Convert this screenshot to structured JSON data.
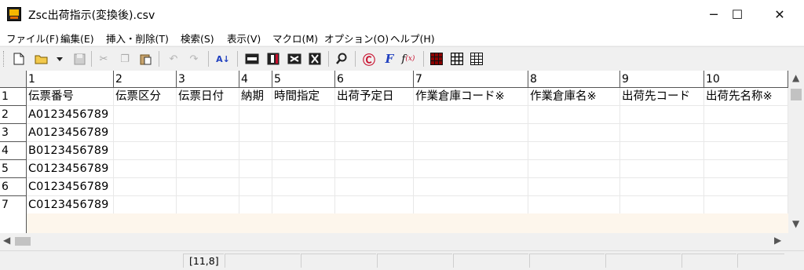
{
  "window": {
    "title": "Zsc出荷指示(変換後).csv",
    "minimize_glyph": "─",
    "maximize_glyph": "☐",
    "close_glyph": "✕"
  },
  "menu": [
    "ファイル(F)",
    "編集(E)",
    "挿入・削除(T)",
    "検索(S)",
    "表示(V)",
    "マクロ(M)",
    "オプション(O)",
    "ヘルプ(H)"
  ],
  "toolbar": {
    "icons": [
      "new-file-icon",
      "open-folder-icon",
      "dropdown-icon",
      "save-icon",
      "cut-icon",
      "copy-icon",
      "paste-icon",
      "undo-icon",
      "redo-icon",
      "sort-az-icon",
      "insert-row-icon",
      "insert-col-icon",
      "delete-row-icon",
      "delete-col-icon",
      "find-icon",
      "recalc-icon",
      "font-icon",
      "function-icon",
      "grid-bold-icon",
      "grid-icon",
      "grid-plain-icon"
    ],
    "colors": {
      "red": "#c8102e",
      "blue": "#1f3fbf",
      "dark": "#222222"
    }
  },
  "grid": {
    "column_numbers": [
      "1",
      "2",
      "3",
      "4",
      "5",
      "6",
      "7",
      "8",
      "9",
      "10"
    ],
    "header_cells": [
      "伝票番号",
      "伝票区分",
      "伝票日付",
      "納期",
      "時間指定",
      "出荷予定日",
      "作業倉庫コード※",
      "作業倉庫名※",
      "出荷先コード",
      "出荷先名称※"
    ],
    "row_numbers": [
      "1",
      "2",
      "3",
      "4",
      "5",
      "6",
      "7"
    ],
    "data_rows": [
      [
        "A0123456789"
      ],
      [
        "A0123456789"
      ],
      [
        "B0123456789"
      ],
      [
        "C0123456789"
      ],
      [
        "C0123456789"
      ],
      [
        "C0123456789"
      ]
    ]
  },
  "status": {
    "position": "[11,8]"
  }
}
